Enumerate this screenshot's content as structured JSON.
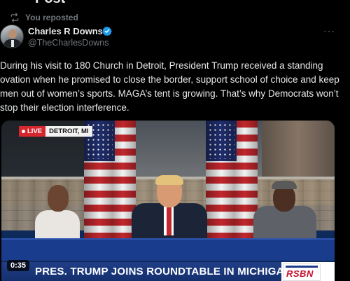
{
  "header": {
    "title": "Post"
  },
  "repost": {
    "label": "You reposted",
    "icon": "repost-icon"
  },
  "author": {
    "name": "Charles R Downs",
    "handle": "@TheCharlesDowns",
    "verified": true,
    "verified_color": "#1d9bf0"
  },
  "more_label": "···",
  "tweet": {
    "text": "During his visit to 180 Church in Detroit, President Trump received a standing ovation when he promised to close the border, support school of choice and keep men out of women’s sports. MAGA’s tent is growing. That’s why Democrats won’t stop their election interference."
  },
  "video": {
    "live_label": "LIVE",
    "location": "DETROIT, MI",
    "duration": "0:35",
    "headline": "PRES. TRUMP JOINS ROUNDTABLE IN MICHIGAN",
    "channel_logo": "RSBN"
  },
  "colors": {
    "background": "#000000",
    "text": "#e7e9ea",
    "muted": "#71767b",
    "live_red": "#d7262e",
    "banner_blue": "#1a3c8c"
  }
}
